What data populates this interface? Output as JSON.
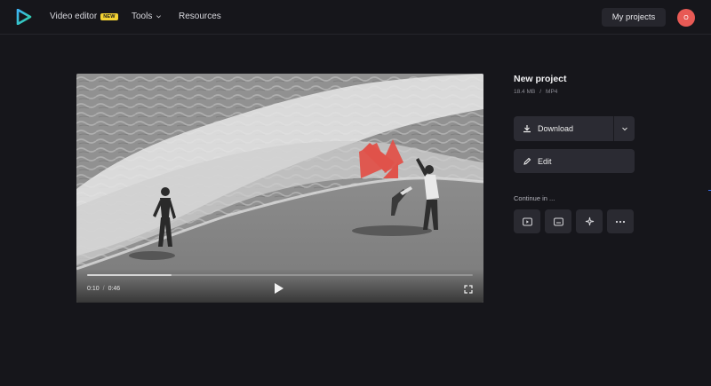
{
  "nav": {
    "video_editor": "Video editor",
    "new_badge": "NEW",
    "tools": "Tools",
    "resources": "Resources",
    "my_projects": "My projects",
    "avatar_initial": "O"
  },
  "player": {
    "current_time": "0:10",
    "separator": "/",
    "duration": "0:46",
    "progress_fraction": 0.22
  },
  "project": {
    "title": "New project",
    "size": "18.4 MB",
    "meta_separator": "/",
    "format": "MP4"
  },
  "actions": {
    "download_label": "Download",
    "edit_label": "Edit",
    "continue_label": "Continue in ..."
  },
  "continue_icons": [
    "play-icon",
    "subtitles-icon",
    "sparkle-icon",
    "more-icon"
  ],
  "colors": {
    "background": "#16161b",
    "button": "#2b2b33",
    "badge": "#f3d233",
    "avatar": "#e85a55",
    "arrow": "#e0524a"
  }
}
